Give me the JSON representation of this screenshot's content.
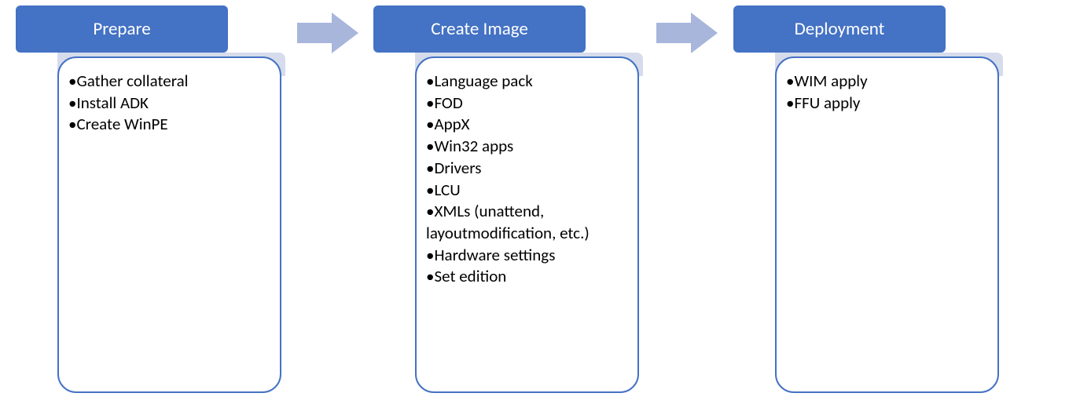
{
  "colors": {
    "accent": "#4472c4",
    "arrow": "#a8b6dc",
    "notch": "#d6dcec",
    "cardBorder": "#4472c4",
    "cardFill": "#ffffff",
    "text": "#000000",
    "headerText": "#ffffff"
  },
  "stages": [
    {
      "title": "Prepare",
      "items": [
        "•Gather collateral",
        "•Install ADK",
        "•Create WinPE"
      ]
    },
    {
      "title": "Create Image",
      "items": [
        "•Language pack",
        "•FOD",
        "•AppX",
        "•Win32 apps",
        "•Drivers",
        "•LCU",
        "•XMLs (unattend, layoutmodification, etc.)",
        "•Hardware settings",
        "•Set edition"
      ]
    },
    {
      "title": "Deployment",
      "items": [
        "•WIM apply",
        "•FFU apply"
      ]
    }
  ]
}
